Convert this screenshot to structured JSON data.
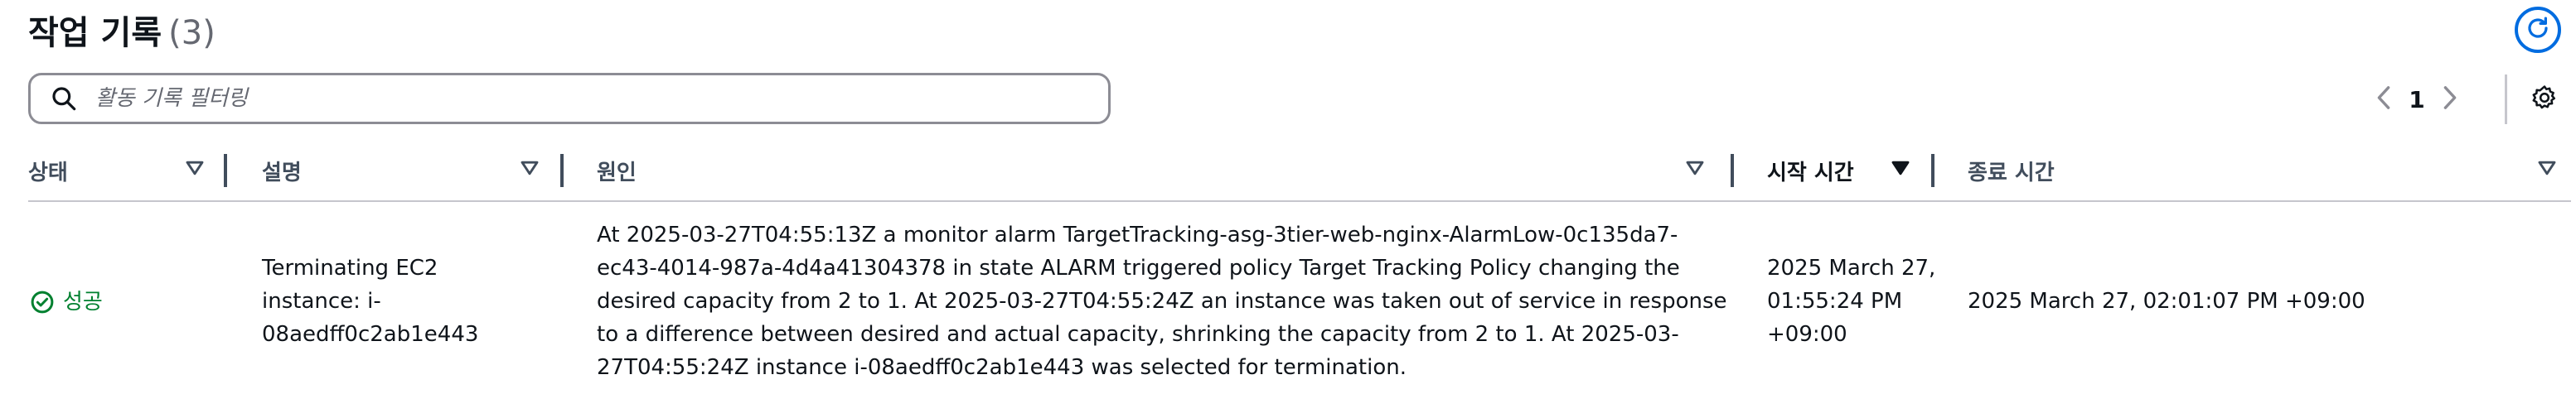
{
  "page": {
    "title": "작업 기록",
    "count": "(3)"
  },
  "search": {
    "placeholder": "활동 기록 필터링",
    "value": ""
  },
  "pagination": {
    "current_page": "1"
  },
  "table": {
    "columns": [
      {
        "label": "상태"
      },
      {
        "label": "설명"
      },
      {
        "label": "원인"
      },
      {
        "label": "시작 시간"
      },
      {
        "label": "종료 시간"
      }
    ],
    "rows": [
      {
        "status": "성공",
        "description": "Terminating EC2 instance: i-08aedff0c2ab1e443",
        "cause": "At 2025-03-27T04:55:13Z a monitor alarm TargetTracking-asg-3tier-web-nginx-AlarmLow-0c135da7-ec43-4014-987a-4d4a41304378 in state ALARM triggered policy Target Tracking Policy changing the desired capacity from 2 to 1. At 2025-03-27T04:55:24Z an instance was taken out of service in response to a difference between desired and actual capacity, shrinking the capacity from 2 to 1. At 2025-03-27T04:55:24Z instance i-08aedff0c2ab1e443 was selected for termination.",
        "start_time": "2025 March 27, 01:55:24 PM +09:00",
        "end_time": "2025 March 27, 02:01:07 PM +09:00"
      }
    ]
  },
  "colors": {
    "accent": "#006ce0",
    "success": "#00802f",
    "text": "#0f141a",
    "header_text": "#414d5c",
    "border": "#8c8c94"
  },
  "icons": {
    "refresh": "refresh-icon",
    "search": "search-icon",
    "prev": "chevron-left-icon",
    "next": "chevron-right-icon",
    "settings": "gear-icon",
    "sort": "sort-triangle-icon",
    "success": "check-circle-icon"
  }
}
